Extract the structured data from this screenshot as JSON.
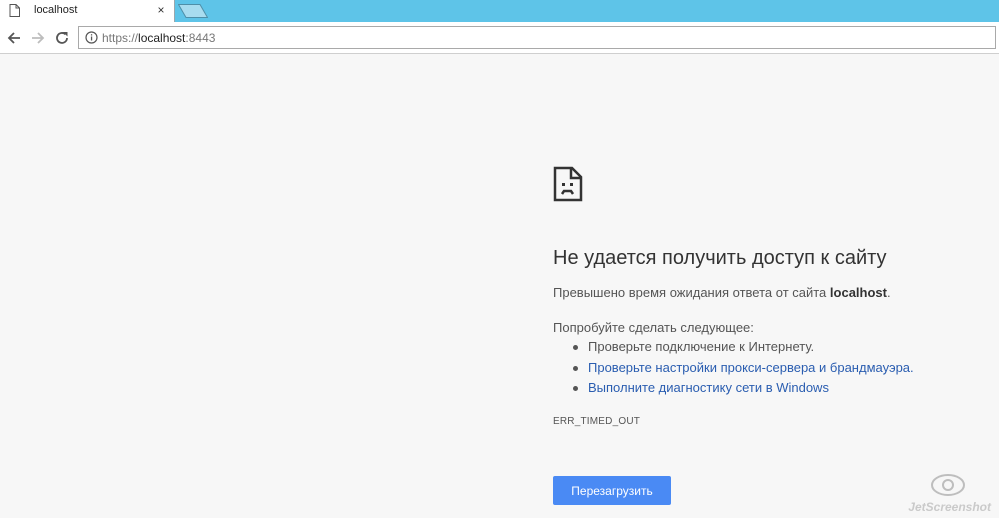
{
  "tab": {
    "title": "localhost",
    "close_glyph": "×"
  },
  "toolbar": {
    "url_scheme": "https://",
    "url_host": "localhost",
    "url_port": ":8443"
  },
  "error": {
    "heading": "Не удается получить доступ к сайту",
    "desc_prefix": "Превышено время ожидания ответа от сайта ",
    "desc_host": "localhost",
    "desc_suffix": ".",
    "try_label": "Попробуйте сделать следующее:",
    "suggestions": [
      {
        "text": "Проверьте подключение к Интернету."
      },
      {
        "text": "Проверьте настройки прокси-сервера и брандмауэра."
      },
      {
        "text": "Выполните диагностику сети в Windows"
      }
    ],
    "code": "ERR_TIMED_OUT",
    "reload_label": "Перезагрузить"
  },
  "watermark": {
    "text": "JetScreenshot"
  },
  "colors": {
    "tabstrip": "#5ec4e8",
    "page_bg": "#f7f7f7",
    "link": "#2a5db0",
    "button": "#4a8af4"
  }
}
